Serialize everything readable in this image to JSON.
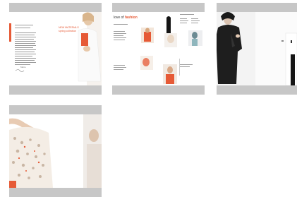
{
  "thumbnails": [
    {
      "name": "magazine-spread-1",
      "header_line_1": "NEW MATERIALS",
      "header_line_2": "spring collection",
      "signature": "Marie"
    },
    {
      "name": "magazine-spread-2",
      "title_word_1": "love of",
      "title_word_2": "fashion"
    },
    {
      "name": "magazine-spread-3"
    },
    {
      "name": "magazine-spread-4"
    }
  ],
  "colors": {
    "bar": "#c7c7c7",
    "accent": "#e65a36",
    "background": "#ffffff"
  }
}
